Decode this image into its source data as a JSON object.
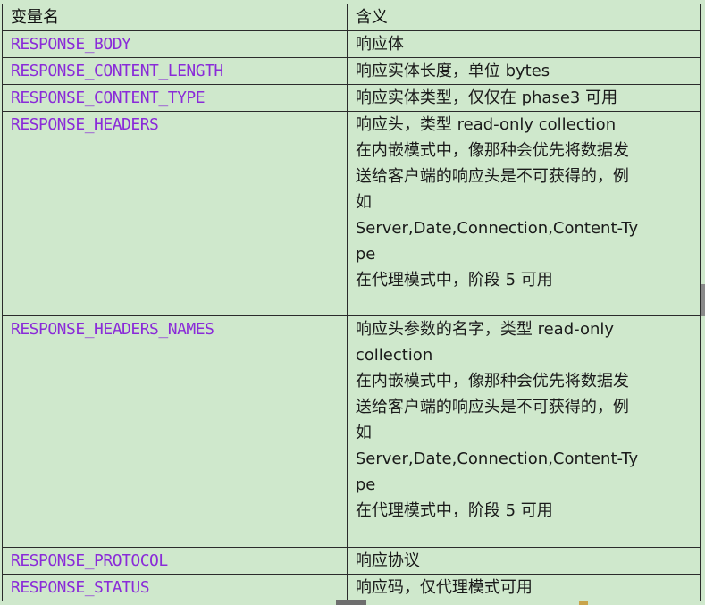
{
  "table": {
    "header": {
      "col1": "变量名",
      "col2": "含义"
    },
    "rows": [
      {
        "name": "RESPONSE_BODY",
        "desc": [
          "响应体"
        ]
      },
      {
        "name": "RESPONSE_CONTENT_LENGTH",
        "desc": [
          "响应实体长度，单位 bytes"
        ]
      },
      {
        "name": "RESPONSE_CONTENT_TYPE",
        "desc": [
          "响应实体类型，仅仅在 phase3 可用"
        ]
      },
      {
        "name": "RESPONSE_HEADERS",
        "desc": [
          "响应头，类型 read-only collection",
          "在内嵌模式中，像那种会优先将数据发",
          "送给客户端的响应头是不可获得的，例",
          "如",
          "Server,Date,Connection,Content-Ty",
          "pe",
          "在代理模式中，阶段 5 可用"
        ]
      },
      {
        "name": "RESPONSE_HEADERS_NAMES",
        "desc": [
          "响应头参数的名字，类型 read-only",
          "collection",
          "在内嵌模式中，像那种会优先将数据发",
          "送给客户端的响应头是不可获得的，例",
          "如",
          "Server,Date,Connection,Content-Ty",
          "pe",
          "在代理模式中，阶段 5 可用"
        ]
      },
      {
        "name": "RESPONSE_PROTOCOL",
        "desc": [
          "响应协议"
        ]
      },
      {
        "name": "RESPONSE_STATUS",
        "desc": [
          "响应码，仅代理模式可用"
        ]
      }
    ]
  },
  "colors": {
    "background": "#cfe8cc",
    "varname": "#8a2bd8",
    "border": "#2b2b2b"
  }
}
